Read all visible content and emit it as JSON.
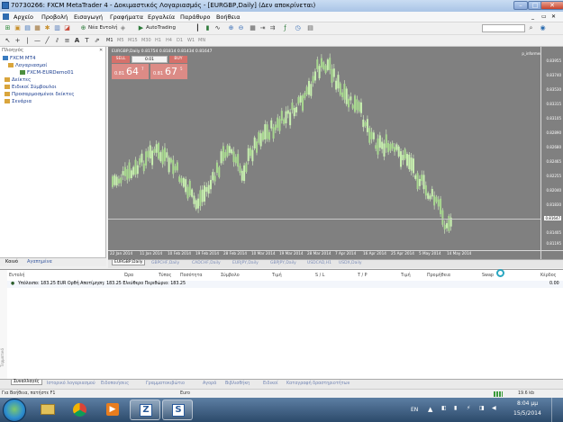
{
  "window": {
    "title": "70730266: FXCM MetaTrader 4 - Δοκιμαστικός Λογαριασμός - [EURGBP,Daily] (Δεν αποκρίνεται)"
  },
  "menu": [
    "Αρχείο",
    "Προβολή",
    "Εισαγωγή",
    "Γραφήματα",
    "Εργαλεία",
    "Παράθυρο",
    "Βοήθεια"
  ],
  "toolbar": {
    "new_order": "Νέα Εντολή",
    "autotrading": "AutoTrading",
    "timeframes": [
      "M1",
      "M5",
      "M15",
      "M30",
      "H1",
      "H4",
      "D1",
      "W1",
      "MN"
    ]
  },
  "navigator": {
    "title": "Πλοηγός",
    "root": "FXCM MT4",
    "items": [
      {
        "label": "Λογαριασμοί",
        "color": "#d9a53c"
      },
      {
        "label": "FXCM-EURDemo01",
        "color": "#4d8f3f"
      },
      {
        "label": "Δείκτες",
        "color": "#d9a53c"
      },
      {
        "label": "Ειδικοί Σύμβουλοι",
        "color": "#d9a53c"
      },
      {
        "label": "Προσαρμοσμένοι δείκτες",
        "color": "#d9a53c"
      },
      {
        "label": "Σενάρια",
        "color": "#d9a53c"
      }
    ],
    "tabs": [
      "Κοινό",
      "Αγαπημένα"
    ]
  },
  "chart": {
    "header": "EURGBP,Daily  0.81754 0.81814 0.81434 0.81647",
    "expert": "p_informer",
    "trade_panel": {
      "sell": "SELL",
      "buy": "BUY",
      "lot": "0.01",
      "sell_price_small": "0.81",
      "sell_price_big": "64",
      "sell_price_sup": "7",
      "buy_price_small": "0.81",
      "buy_price_big": "67",
      "buy_price_sup": "5"
    },
    "price_labels": [
      "0.83955",
      "0.83740",
      "0.83530",
      "0.83315",
      "0.83105",
      "0.82890",
      "0.82680",
      "0.82465",
      "0.82255",
      "0.82040",
      "0.81830",
      "0.81647",
      "0.81405",
      "0.81195"
    ],
    "current_price": "0.81647",
    "date_labels": [
      "22 Jan 2014",
      "11 Jan 2014",
      "10 Feb 2014",
      "19 Feb 2014",
      "28 Feb 2014",
      "10 Mar 2014",
      "19 Mar 2014",
      "28 Mar 2014",
      "7 Apr 2014",
      "16 Apr 2014",
      "25 Apr 2014",
      "5 May 2014",
      "14 May 2014"
    ],
    "colors": {
      "bg": "#808080",
      "candle": "#c8f0b0",
      "grid": "#909090"
    }
  },
  "chart_tabs": [
    "EURGBP,Daily",
    "GBPCHF,Daily",
    "CADCHF,Daily",
    "EURJPY,Daily",
    "GBPJPY,Daily",
    "USDCAD,H1",
    "USDX,Daily"
  ],
  "terminal": {
    "columns": [
      "Εντολή",
      "Ώρα",
      "Τύπος",
      "Ποσότητα",
      "Σύμβολο",
      "Τιμή",
      "S / L",
      "T / P",
      "Τιμή",
      "Προμήθεια",
      "Swap",
      "Κέρδος"
    ],
    "balance_text": "Υπόλοιπο: 183.25 EUR  Ορθή Αποτίμηση: 183.25  Ελεύθερο Περιθώριο: 183.25",
    "profit": "0.00",
    "side_label": "Τερματικό",
    "tabs": [
      "Συναλλαγές",
      "Ιστορικό λογαριασμού",
      "Ειδοποιήσεις",
      "Γραμματοκιβώτιο",
      "Αγορά",
      "Βιβλιοθήκη",
      "Ειδικοί",
      "Καταγραφή δραστηριοτήτων"
    ]
  },
  "status": {
    "help": "Για Βοήθεια, πατήστε F1",
    "profile": "Euro",
    "traffic": "19.6 kb"
  },
  "taskbar": {
    "lang": "EN",
    "time": "8:04 μμ",
    "date": "15/5/2014"
  }
}
